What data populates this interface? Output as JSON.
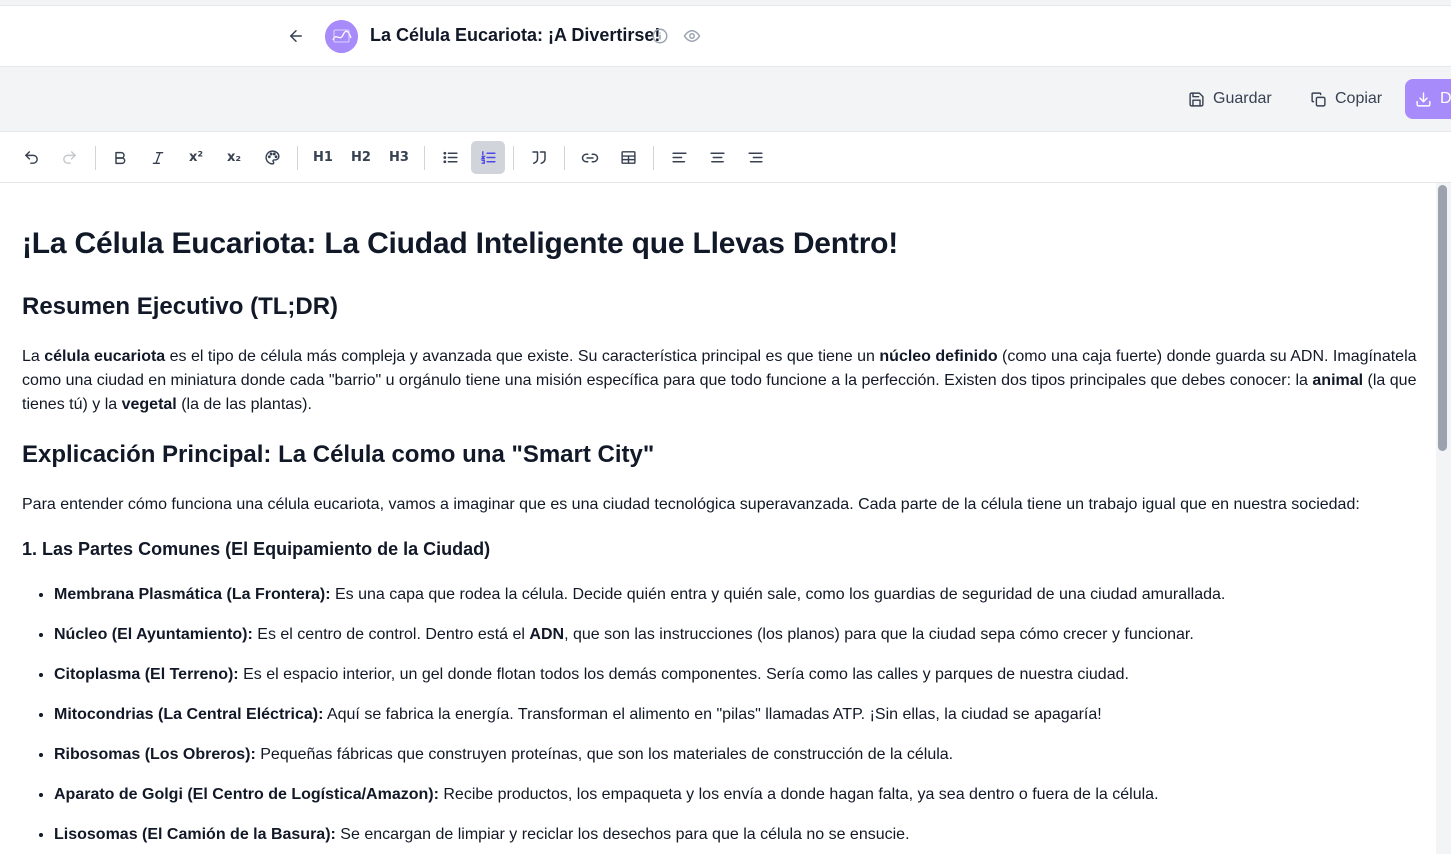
{
  "header": {
    "title": "La Célula Eucariota: ¡A Divertirse!"
  },
  "actions": {
    "save_label": "Guardar",
    "copy_label": "Copiar",
    "download_label": "D"
  },
  "toolbar": {
    "h1": "H1",
    "h2": "H2",
    "h3": "H3",
    "superscript": "x²",
    "subscript": "x₂",
    "active_tool": "ordered-list"
  },
  "document": {
    "h1": "¡La Célula Eucariota: La Ciudad Inteligente que Llevas Dentro!",
    "summary_heading": "Resumen Ejecutivo (TL;DR)",
    "summary": {
      "t1": "La ",
      "b1": "célula eucariota",
      "t2": " es el tipo de célula más compleja y avanzada que existe. Su característica principal es que tiene un ",
      "b2": "núcleo definido",
      "t3": " (como una caja fuerte) donde guarda su ADN. Imagínatela como una ciudad en miniatura donde cada \"barrio\" u orgánulo tiene una misión específica para que todo funcione a la perfección. Existen dos tipos principales que debes conocer: la ",
      "b3": "animal",
      "t4": " (la que tienes tú) y la ",
      "b4": "vegetal",
      "t5": " (la de las plantas)."
    },
    "main_heading": "Explicación Principal: La Célula como una \"Smart City\"",
    "main_intro": "Para entender cómo funciona una célula eucariota, vamos a imaginar que es una ciudad tecnológica superavanzada. Cada parte de la célula tiene un trabajo igual que en nuestra sociedad:",
    "section1_heading": "1. Las Partes Comunes (El Equipamiento de la Ciudad)",
    "items": [
      {
        "term": "Membrana Plasmática (La Frontera):",
        "text": " Es una capa que rodea la célula. Decide quién entra y quién sale, como los guardias de seguridad de una ciudad amurallada."
      },
      {
        "term": "Núcleo (El Ayuntamiento):",
        "text": " Es el centro de control. Dentro está el ",
        "bold2": "ADN",
        "text2": ", que son las instrucciones (los planos) para que la ciudad sepa cómo crecer y funcionar."
      },
      {
        "term": "Citoplasma (El Terreno):",
        "text": " Es el espacio interior, un gel donde flotan todos los demás componentes. Sería como las calles y parques de nuestra ciudad."
      },
      {
        "term": "Mitocondrias (La Central Eléctrica):",
        "text": " Aquí se fabrica la energía. Transforman el alimento en \"pilas\" llamadas ATP. ¡Sin ellas, la ciudad se apagaría!"
      },
      {
        "term": "Ribosomas (Los Obreros):",
        "text": " Pequeñas fábricas que construyen proteínas, que son los materiales de construcción de la célula."
      },
      {
        "term": "Aparato de Golgi (El Centro de Logística/Amazon):",
        "text": " Recibe productos, los empaqueta y los envía a donde hagan falta, ya sea dentro o fuera de la célula."
      },
      {
        "term": "Lisosomas (El Camión de la Basura):",
        "text": " Se encargan de limpiar y reciclar los desechos para que la célula no se ensucie."
      }
    ]
  }
}
